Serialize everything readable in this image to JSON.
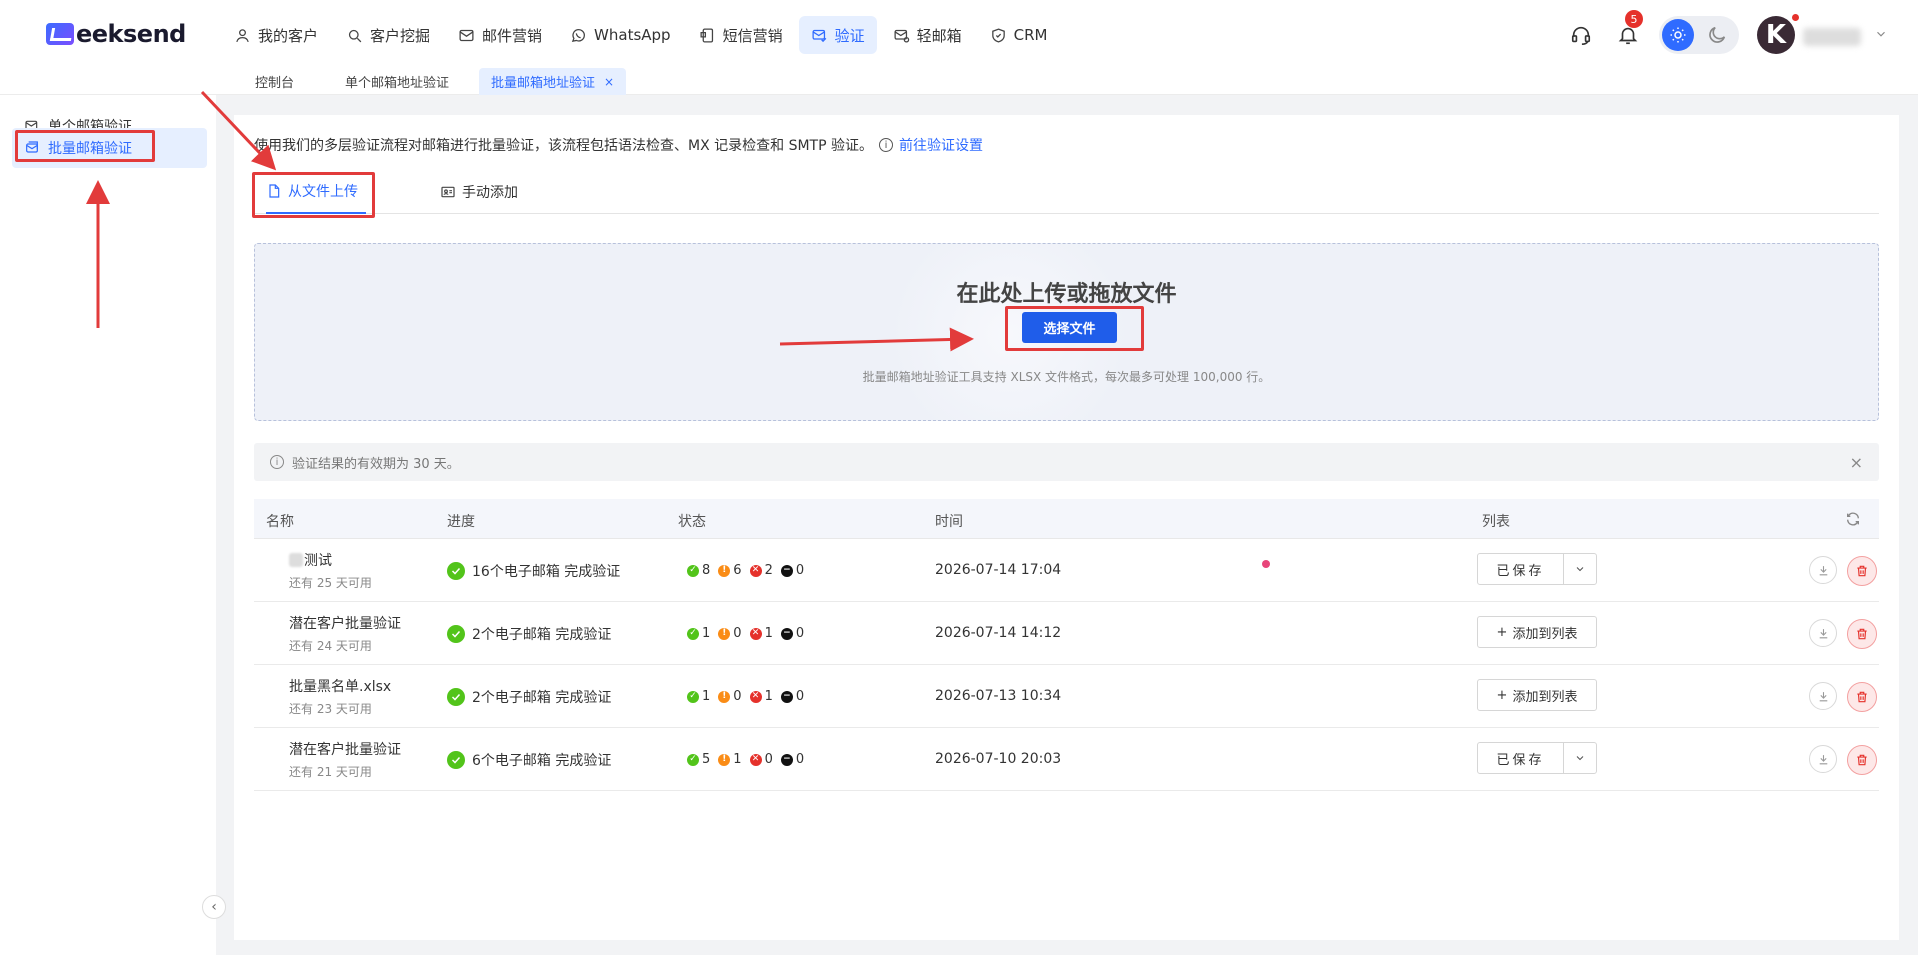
{
  "brand": {
    "logo_text": "eeksend"
  },
  "nav": [
    {
      "label": "我的客户",
      "icon": "user-icon"
    },
    {
      "label": "客户挖掘",
      "icon": "search-icon"
    },
    {
      "label": "邮件营销",
      "icon": "mail-icon"
    },
    {
      "label": "WhatsApp",
      "icon": "whatsapp-icon"
    },
    {
      "label": "短信营销",
      "icon": "sms-icon"
    },
    {
      "label": "验证",
      "icon": "verify-mail-icon",
      "active": true
    },
    {
      "label": "轻邮箱",
      "icon": "mail-light-icon"
    },
    {
      "label": "CRM",
      "icon": "crm-icon"
    }
  ],
  "header": {
    "notification_count": "5",
    "avatar_letter": "K"
  },
  "page_tabs": [
    {
      "label": "控制台"
    },
    {
      "label": "单个邮箱地址验证"
    },
    {
      "label": "批量邮箱地址验证",
      "active": true,
      "close": "×"
    }
  ],
  "sidebar": {
    "items": [
      {
        "label": "单个邮箱验证",
        "icon": "mail-check-icon"
      },
      {
        "label": "批量邮箱验证",
        "icon": "bulk-mail-icon",
        "active": true
      }
    ],
    "collapse_glyph": "‹"
  },
  "main": {
    "intro_text": "使用我们的多层验证流程对邮箱进行批量验证，该流程包括语法检查、MX 记录检查和 SMTP 验证。",
    "intro_link": "前往验证设置",
    "tabs": [
      {
        "label": "从文件上传",
        "icon": "file-icon",
        "active": true
      },
      {
        "label": "手动添加",
        "icon": "contact-card-icon"
      }
    ],
    "upload": {
      "title": "在此处上传或拖放文件",
      "button": "选择文件",
      "hint": "批量邮箱地址验证工具支持 XLSX 文件格式，每次最多可处理 100,000 行。"
    },
    "notice": {
      "text": "验证结果的有效期为 30 天。",
      "close": "×"
    }
  },
  "table": {
    "headers": {
      "name": "名称",
      "progress": "进度",
      "status": "状态",
      "time": "时间",
      "list": "列表"
    },
    "rows": [
      {
        "name": "测试",
        "name_blurred_prefix": true,
        "sub": "还有 25 天可用",
        "progress": "16个电子邮箱 完成验证",
        "ok": "8",
        "warn": "6",
        "bad": "2",
        "unknown": "0",
        "time": "2026-07-14 17:04",
        "list_type": "saved",
        "list_label": "已保存"
      },
      {
        "name": "潜在客户批量验证",
        "sub": "还有 24 天可用",
        "progress": "2个电子邮箱 完成验证",
        "ok": "1",
        "warn": "0",
        "bad": "1",
        "unknown": "0",
        "time": "2026-07-14 14:12",
        "list_type": "add",
        "list_label": "添加到列表"
      },
      {
        "name": "批量黑名单.xlsx",
        "sub": "还有 23 天可用",
        "progress": "2个电子邮箱 完成验证",
        "ok": "1",
        "warn": "0",
        "bad": "1",
        "unknown": "0",
        "time": "2026-07-13 10:34",
        "list_type": "add",
        "list_label": "添加到列表"
      },
      {
        "name": "潜在客户批量验证",
        "sub": "还有 21 天可用",
        "progress": "6个电子邮箱 完成验证",
        "ok": "5",
        "warn": "1",
        "bad": "0",
        "unknown": "0",
        "time": "2026-07-10 20:03",
        "list_type": "saved",
        "list_label": "已保存"
      }
    ]
  },
  "colors": {
    "accent": "#2f6bff",
    "success": "#52c41a",
    "warning": "#fa8c16",
    "danger": "#e5312b",
    "annotation": "#e23b3b"
  }
}
